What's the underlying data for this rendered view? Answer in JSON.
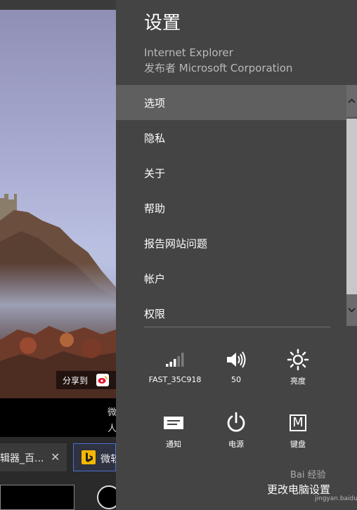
{
  "browser": {
    "share_label": "分享到",
    "caption_line1": "微",
    "caption_line2": "人",
    "tab1_title": "辑器_百...",
    "tab1_close": "✕",
    "tab2_title": "微软",
    "tab2_icon": "bing-icon"
  },
  "settings": {
    "title": "设置",
    "app_name": "Internet Explorer",
    "publisher": "发布者 Microsoft Corporation",
    "menu": [
      {
        "label": "选项",
        "selected": true
      },
      {
        "label": "隐私",
        "selected": false
      },
      {
        "label": "关于",
        "selected": false
      },
      {
        "label": "帮助",
        "selected": false
      },
      {
        "label": "报告网站问题",
        "selected": false
      },
      {
        "label": "帐户",
        "selected": false
      },
      {
        "label": "权限",
        "selected": false
      }
    ],
    "quick_settings": {
      "network": {
        "label": "FAST_35C918",
        "icon": "wifi-signal-icon"
      },
      "volume": {
        "label": "50",
        "icon": "speaker-icon"
      },
      "brightness": {
        "label": "亮度",
        "icon": "sun-icon"
      },
      "notifications": {
        "label": "通知",
        "icon": "notification-icon"
      },
      "power": {
        "label": "电源",
        "icon": "power-icon"
      },
      "keyboard": {
        "label": "键盘",
        "icon": "keyboard-icon",
        "glyph": "M"
      }
    },
    "change_pc_settings": "更改电脑设置",
    "watermark": "Bai 经验",
    "watermark_url": "jingyan.baidu.com"
  },
  "colors": {
    "charm_bg": "#444444",
    "selected_bg": "#5f5f5f",
    "text": "#ffffff",
    "subtext": "#b9b9b9"
  }
}
